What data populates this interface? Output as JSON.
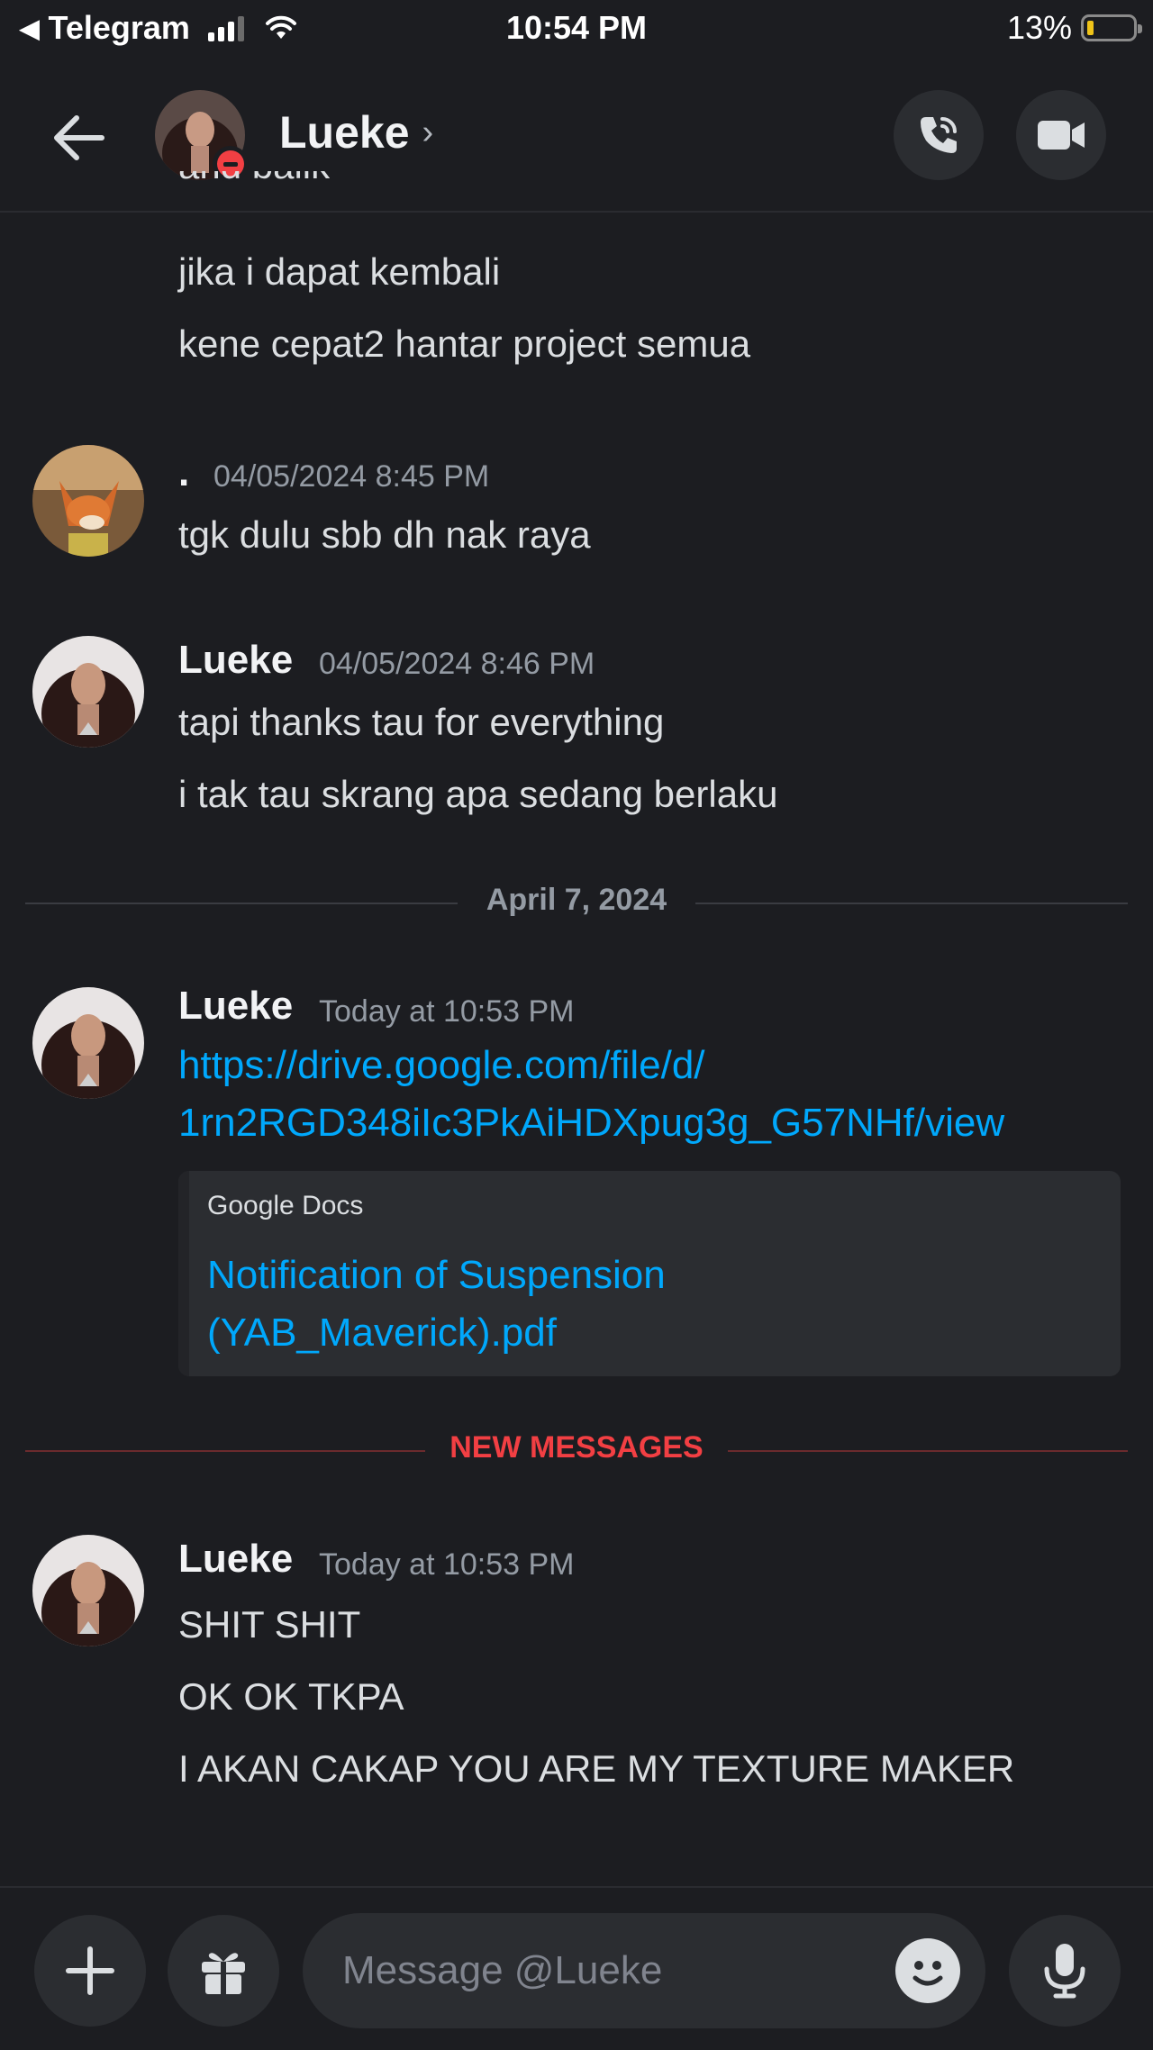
{
  "status_bar": {
    "back_app": "Telegram",
    "time": "10:54 PM",
    "battery": "13%",
    "battery_level": 0.13,
    "signal_bars": 3
  },
  "header": {
    "name": "Lueke",
    "chevron": "›",
    "status": "do-not-disturb"
  },
  "messages": {
    "clipped_line": "and balik",
    "prev_lines": [
      "jika i dapat kembali",
      "kene cepat2 hantar project semua"
    ],
    "m1": {
      "author": ".",
      "timestamp": "04/05/2024 8:45 PM",
      "lines": [
        "tgk dulu sbb dh nak raya"
      ]
    },
    "m2": {
      "author": "Lueke",
      "timestamp": "04/05/2024 8:46 PM",
      "lines": [
        "tapi thanks tau for everything",
        "i tak tau skrang apa sedang berlaku"
      ]
    },
    "date_divider": "April 7, 2024",
    "m3": {
      "author": "Lueke",
      "timestamp": "Today at 10:53 PM",
      "link_lines": [
        "https://drive.google.com/file/d/",
        "1rn2RGD348iIc3PkAiHDXpug3g_G57NHf/view"
      ],
      "embed": {
        "provider": "Google Docs",
        "title_lines": [
          "Notification of Suspension",
          "(YAB_Maverick).pdf"
        ]
      }
    },
    "new_divider": "NEW MESSAGES",
    "m4": {
      "author": "Lueke",
      "timestamp": "Today at 10:53 PM",
      "lines": [
        "SHIT SHIT",
        "OK OK TKPA",
        "I AKAN CAKAP YOU ARE MY TEXTURE MAKER"
      ]
    }
  },
  "composer": {
    "placeholder": "Message @Lueke"
  },
  "icons": [
    "back-arrow-icon",
    "phone-icon",
    "video-camera-icon",
    "plus-icon",
    "gift-icon",
    "emoji-icon",
    "microphone-icon",
    "wifi-icon",
    "battery-icon"
  ],
  "colors": {
    "background": "#1c1d21",
    "link": "#00a8fc",
    "new_messages": "#f23f43",
    "dnd": "#f23f43"
  }
}
